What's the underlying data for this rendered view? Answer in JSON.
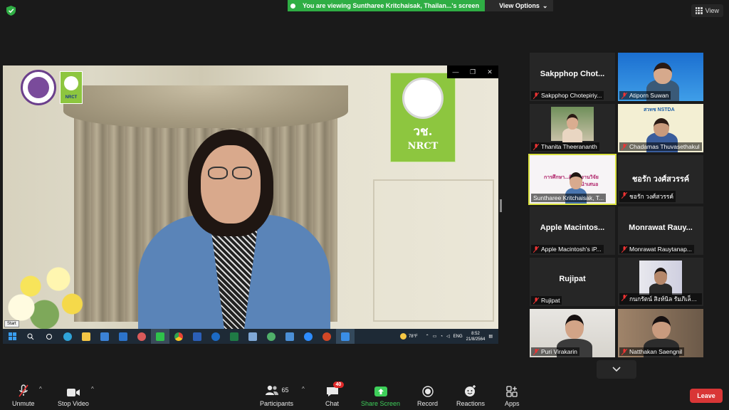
{
  "banner": {
    "message": "You are viewing Suntharee Kritchaisak, Thailan...'s screen",
    "view_options": "View Options",
    "view_button": "View"
  },
  "shared_screen": {
    "sign_thai": "วช.",
    "sign_en": "NRCT",
    "small_logo_text": "NRCT",
    "start_tooltip": "Start",
    "taskbar": {
      "temperature": "78°F",
      "language": "ENG",
      "time": "8:52",
      "date": "21/8/2564"
    }
  },
  "participants": [
    {
      "display": "Sakpphop Chot...",
      "name": "Sakpphop Chotepiriy...",
      "video": false
    },
    {
      "display": "",
      "name": "Atiporn Suwan",
      "video": true
    },
    {
      "display": "",
      "name": "Thanita Theerananth",
      "video": true
    },
    {
      "display": "",
      "name": "Chadamas Thuvasethakul",
      "video": true
    },
    {
      "display": "",
      "name": "Suntharee Kritchaisak, T...",
      "video": true,
      "active": true
    },
    {
      "display": "ชอรัก วงศ์สวรรค์",
      "name": "ชอรัก วงศ์สวรรค์",
      "video": false
    },
    {
      "display": "Apple Macintos...",
      "name": "Apple Macintosh's iP...",
      "video": false
    },
    {
      "display": "Monrawat Rauy...",
      "name": "Monrawat Rauytanap...",
      "video": false
    },
    {
      "display": "Rujipat",
      "name": "Rujipat",
      "video": false
    },
    {
      "display": "",
      "name": "กนกรัตน์ สิงห์นิล รัมภิเล็ม...",
      "video": true
    },
    {
      "display": "",
      "name": "Puri Virakarin",
      "video": true
    },
    {
      "display": "",
      "name": "Natthakan Saengnil",
      "video": true
    }
  ],
  "tile_texts": {
    "t5_line1": "การศึกษา...ดิจิทัลงานวิจัย",
    "t5_line2": "การนำเสนอ",
    "t4_logo": "สวทช NSTDA"
  },
  "toolbar": {
    "unmute": "Unmute",
    "stop_video": "Stop Video",
    "participants": "Participants",
    "participants_count": "65",
    "chat": "Chat",
    "chat_badge": "40",
    "share_screen": "Share Screen",
    "record": "Record",
    "reactions": "Reactions",
    "apps": "Apps",
    "leave": "Leave"
  },
  "colors": {
    "banner_green": "#2fae44",
    "leave_red": "#d93636",
    "share_green": "#3ecf5a",
    "active_speaker": "#d7df3e"
  }
}
